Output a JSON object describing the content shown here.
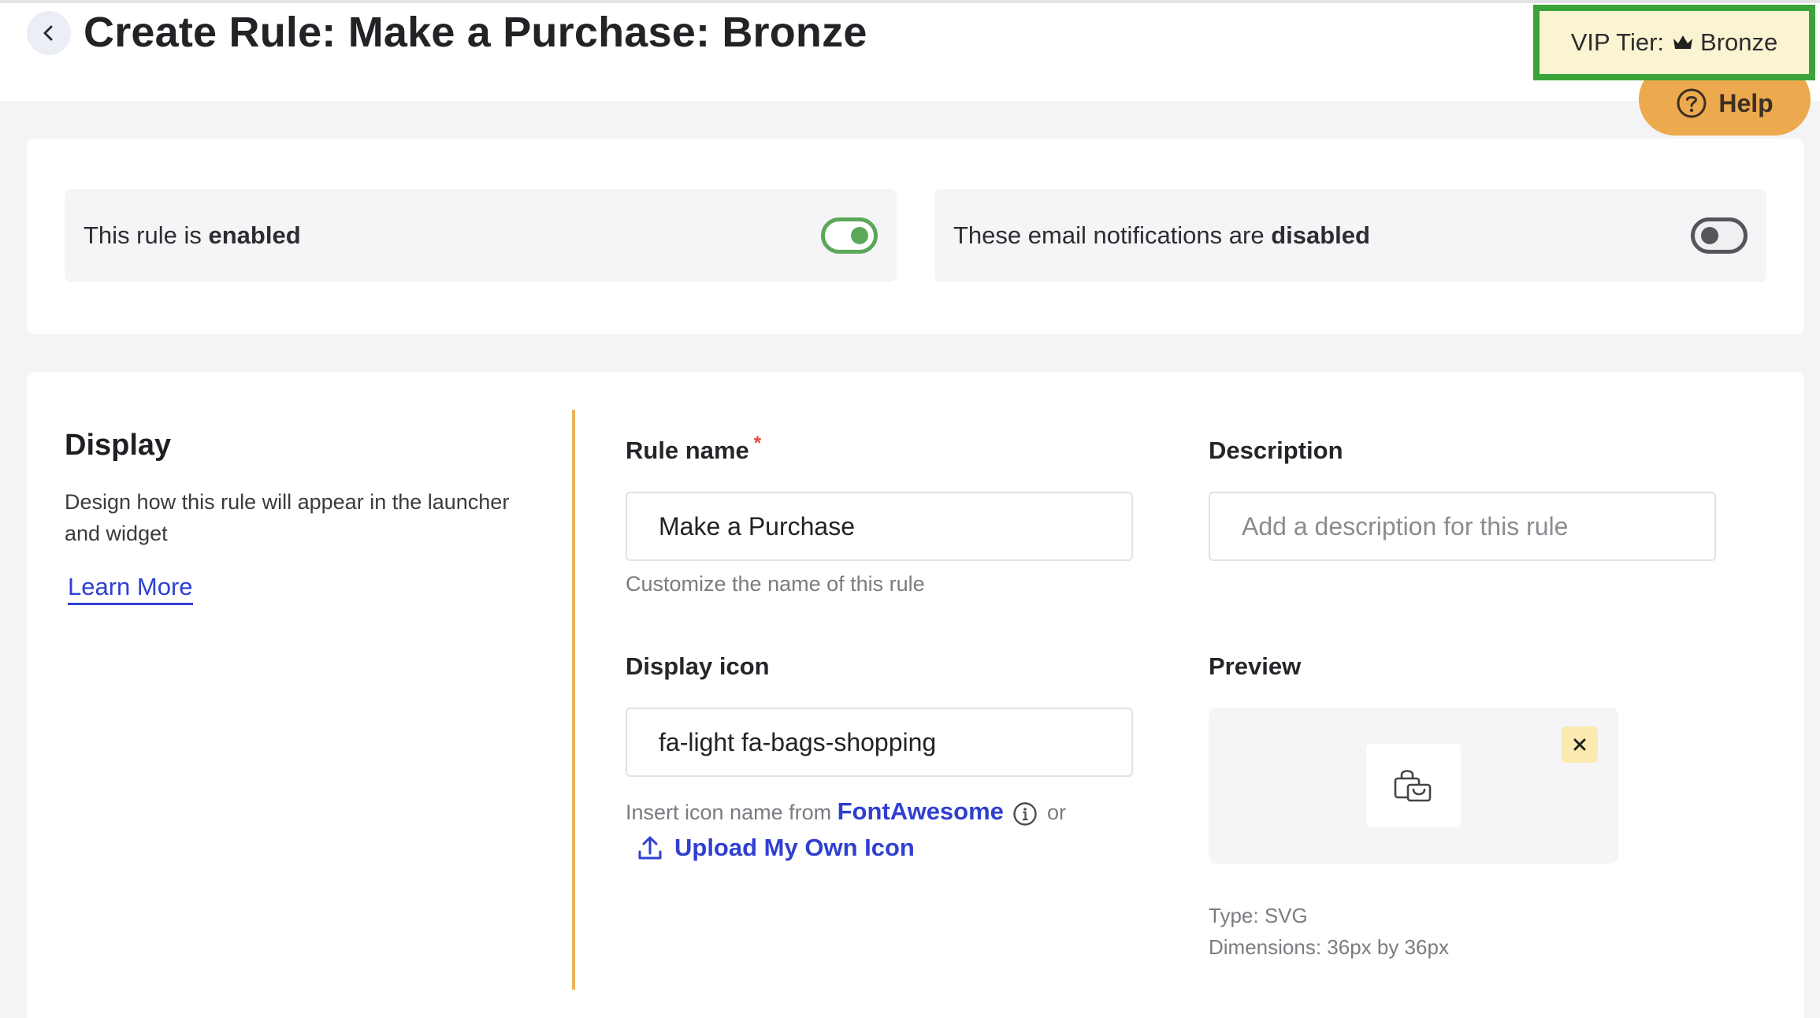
{
  "header": {
    "title": "Create Rule: Make a Purchase: Bronze",
    "vip_tier_label": "VIP Tier:",
    "vip_tier_value": "Bronze",
    "help_label": "Help"
  },
  "toggles": {
    "rule": {
      "prefix": "This rule is ",
      "state": "enabled",
      "on": true
    },
    "email": {
      "prefix": "These email notifications are ",
      "state": "disabled",
      "on": false
    }
  },
  "display": {
    "title": "Display",
    "description": "Design how this rule will appear in the launcher and widget",
    "learn_more": "Learn More",
    "rule_name": {
      "label": "Rule name",
      "required_mark": "*",
      "value": "Make a Purchase",
      "hint": "Customize the name of this rule"
    },
    "description_field": {
      "label": "Description",
      "placeholder": "Add a description for this rule"
    },
    "display_icon": {
      "label": "Display icon",
      "value": "fa-light fa-bags-shopping",
      "hint_prefix": "Insert icon name from",
      "hint_link": "FontAwesome",
      "hint_suffix": "or",
      "upload_label": "Upload My Own Icon"
    },
    "preview": {
      "label": "Preview",
      "type": "Type: SVG",
      "dimensions": "Dimensions: 36px by 36px"
    }
  },
  "icons": {
    "back": "chevron-left-icon",
    "crown": "crown-icon",
    "help": "question-circle-icon",
    "info": "info-icon",
    "upload": "upload-icon",
    "bag": "shopping-bag-icon",
    "close": "close-icon"
  },
  "colors": {
    "accent_link": "#2f3fd0",
    "help_button": "#eda94d",
    "toggle_on": "#5ba85a",
    "divider": "#eeb25a",
    "vip_highlight": "#3aa43a"
  }
}
